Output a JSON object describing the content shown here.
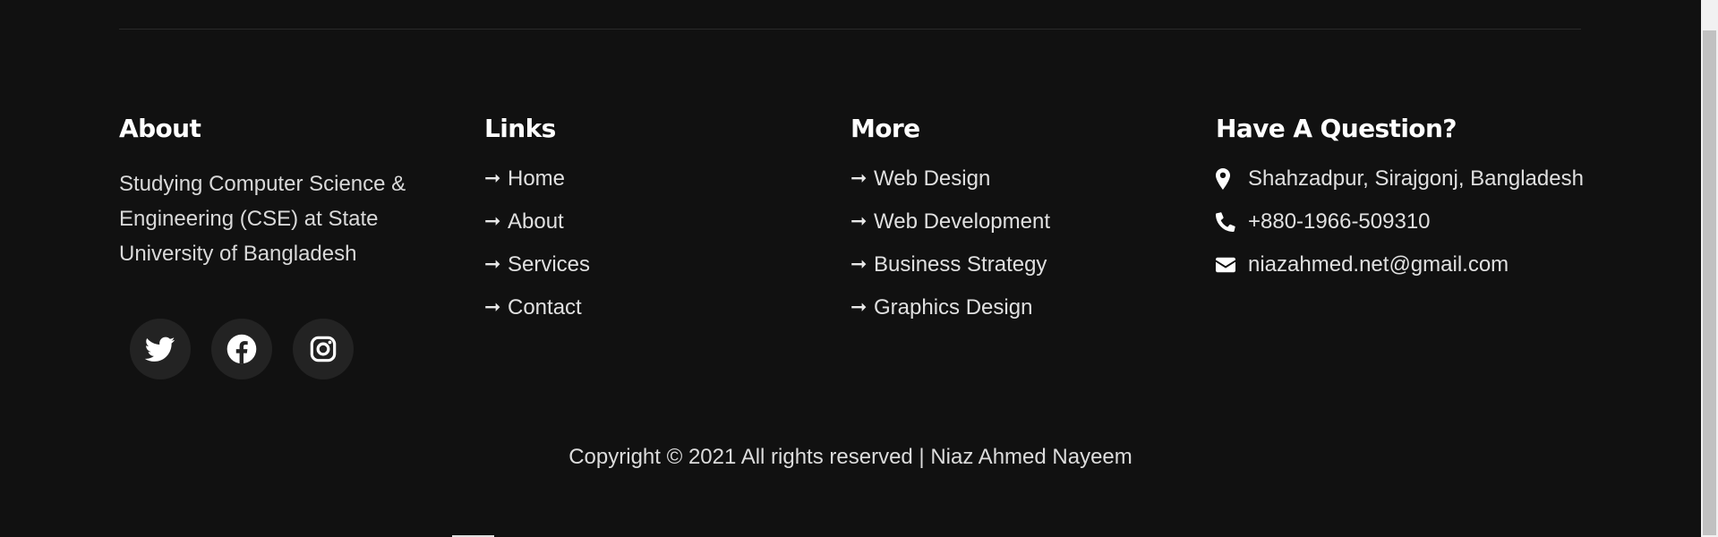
{
  "about": {
    "heading": "About",
    "text": "Studying Computer Science & Engineering (CSE) at State University of Bangladesh",
    "social": [
      {
        "icon": "twitter-icon"
      },
      {
        "icon": "facebook-icon"
      },
      {
        "icon": "instagram-icon"
      }
    ]
  },
  "links": {
    "heading": "Links",
    "arrow": "➞",
    "items": [
      "Home",
      "About",
      "Services",
      "Contact"
    ]
  },
  "more": {
    "heading": "More",
    "arrow": "➞",
    "items": [
      "Web Design",
      "Web Development",
      "Business Strategy",
      "Graphics Design"
    ]
  },
  "question": {
    "heading": "Have A Question?",
    "address": "Shahzadpur, Sirajgonj, Bangladesh",
    "phone": "+880-1966-509310",
    "email": "niazahmed.net@gmail.com"
  },
  "footer": {
    "copyright": "Copyright © 2021 All rights reserved | Niaz Ahmed Nayeem"
  },
  "colors": {
    "background": "#111111",
    "social_button": "#232323",
    "heading": "#ffffff",
    "text": "#e0e0e0"
  }
}
